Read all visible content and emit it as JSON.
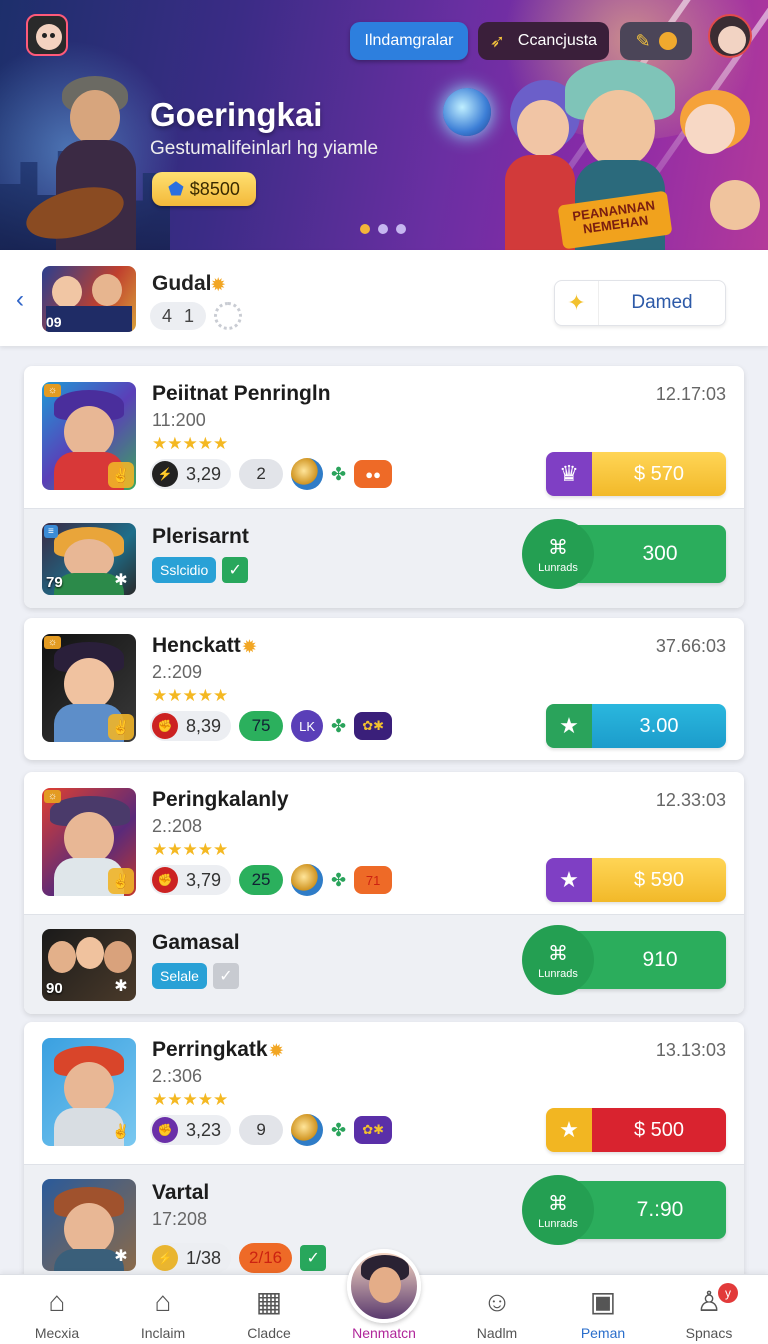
{
  "hero": {
    "title": "Goeringkai",
    "subtitle": "Gestumalifeinlarl hg yiamle",
    "price": "$8500",
    "btn_primary": "Ilndamgralar",
    "btn_secondary": "Ccancjusta",
    "promo_text": "PEANANNAN NEMEHAN"
  },
  "profile": {
    "name": "Gudal",
    "stat_a": "4",
    "stat_b": "1",
    "thumb_number": "09",
    "action_label": "Damed"
  },
  "items": [
    {
      "title": "Peiitnat Penringln",
      "sub": "11:200",
      "time": "12.17:03",
      "stars": "★★★★★",
      "stat_value": "3,29",
      "stat_badge": "2",
      "chip_b": "",
      "price": "$ 570"
    },
    {
      "title": "Plerisarnt",
      "badge": "Sslcidio",
      "thumb_number": "79",
      "btn_label": "Lunrads",
      "value": "300"
    },
    {
      "title": "Henckatt",
      "sub": "2.:209",
      "time": "37.66:03",
      "stars": "★★★★★",
      "stat_value": "8,39",
      "stat_badge": "75",
      "chip_a": "LK",
      "price": "3.00"
    },
    {
      "title": "Peringkalanly",
      "sub": "2.:208",
      "time": "12.33:03",
      "stars": "★★★★★",
      "stat_value": "3,79",
      "stat_badge": "25",
      "chip_b": "71",
      "price": "$ 590"
    },
    {
      "title": "Gamasal",
      "badge": "Selale",
      "thumb_number": "90",
      "btn_label": "Lunrads",
      "value": "910"
    },
    {
      "title": "Perringkatk",
      "sub": "2.:306",
      "time": "13.13:03",
      "stars": "★★★★★",
      "stat_value": "3,23",
      "stat_badge": "9",
      "price": "$ 500"
    },
    {
      "title": "Vartal",
      "sub": "17:208",
      "stat_value": "1/38",
      "stat_badge": "2/16",
      "btn_label": "Lunrads",
      "value": "7.:90"
    }
  ],
  "nav": [
    {
      "label": "Mecxia",
      "icon": "home-icon"
    },
    {
      "label": "Inclaim",
      "icon": "house-icon"
    },
    {
      "label": "Cladce",
      "icon": "grid-icon"
    },
    {
      "label": "Nenmatcn",
      "icon": "avatar"
    },
    {
      "label": "Nadlm",
      "icon": "face-icon"
    },
    {
      "label": "Peman",
      "icon": "store-icon"
    },
    {
      "label": "Spnacs",
      "icon": "profile-icon",
      "badge": "y"
    }
  ],
  "colors": {
    "accent_purple": "#7f3fc4",
    "accent_green": "#2bad5c",
    "accent_yellow": "#f2b929",
    "accent_red": "#d9232f",
    "accent_blue": "#2d7fde"
  }
}
